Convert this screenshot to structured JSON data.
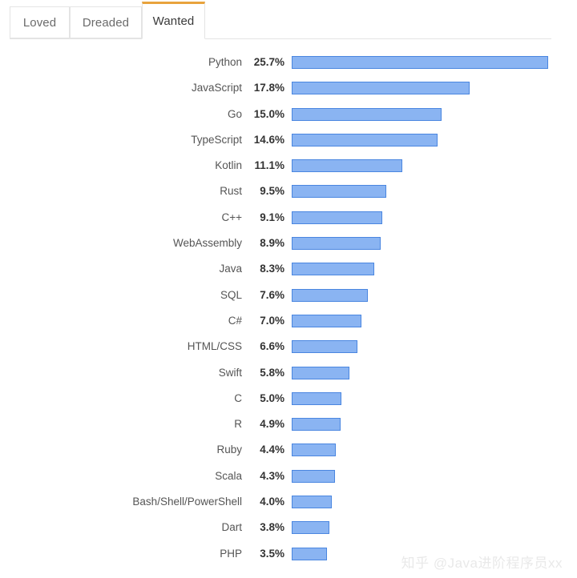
{
  "tabs": [
    {
      "label": "Loved",
      "active": false,
      "name": "tab-loved"
    },
    {
      "label": "Dreaded",
      "active": false,
      "name": "tab-dreaded"
    },
    {
      "label": "Wanted",
      "active": true,
      "name": "tab-wanted"
    }
  ],
  "watermark": {
    "text": "知乎 @Java进阶程序员xx"
  },
  "colors": {
    "bar_fill": "#8ab4f2",
    "bar_border": "#4a86e0",
    "active_tab_accent": "#e8a33d",
    "tab_border": "#e4e4e4",
    "label_text": "#555555",
    "value_text": "#333333",
    "watermark_text": "#e9e9e9",
    "background": "#ffffff"
  },
  "chart_data": {
    "type": "bar",
    "title": "",
    "subtitle": "",
    "xlabel": "",
    "ylabel": "",
    "orientation": "horizontal",
    "grid": false,
    "legend": "none",
    "xlim": [
      0,
      25.7
    ],
    "value_suffix": "%",
    "categories": [
      "Python",
      "JavaScript",
      "Go",
      "TypeScript",
      "Kotlin",
      "Rust",
      "C++",
      "WebAssembly",
      "Java",
      "SQL",
      "C#",
      "HTML/CSS",
      "Swift",
      "C",
      "R",
      "Ruby",
      "Scala",
      "Bash/Shell/PowerShell",
      "Dart",
      "PHP"
    ],
    "values": [
      25.7,
      17.8,
      15.0,
      14.6,
      11.1,
      9.5,
      9.1,
      8.9,
      8.3,
      7.6,
      7.0,
      6.6,
      5.8,
      5.0,
      4.9,
      4.4,
      4.3,
      4.0,
      3.8,
      3.5
    ],
    "value_labels": [
      "25.7%",
      "17.8%",
      "15.0%",
      "14.6%",
      "11.1%",
      "9.5%",
      "9.1%",
      "8.9%",
      "8.3%",
      "7.6%",
      "7.0%",
      "6.6%",
      "5.8%",
      "5.0%",
      "4.9%",
      "4.4%",
      "4.3%",
      "4.0%",
      "3.8%",
      "3.5%"
    ]
  }
}
